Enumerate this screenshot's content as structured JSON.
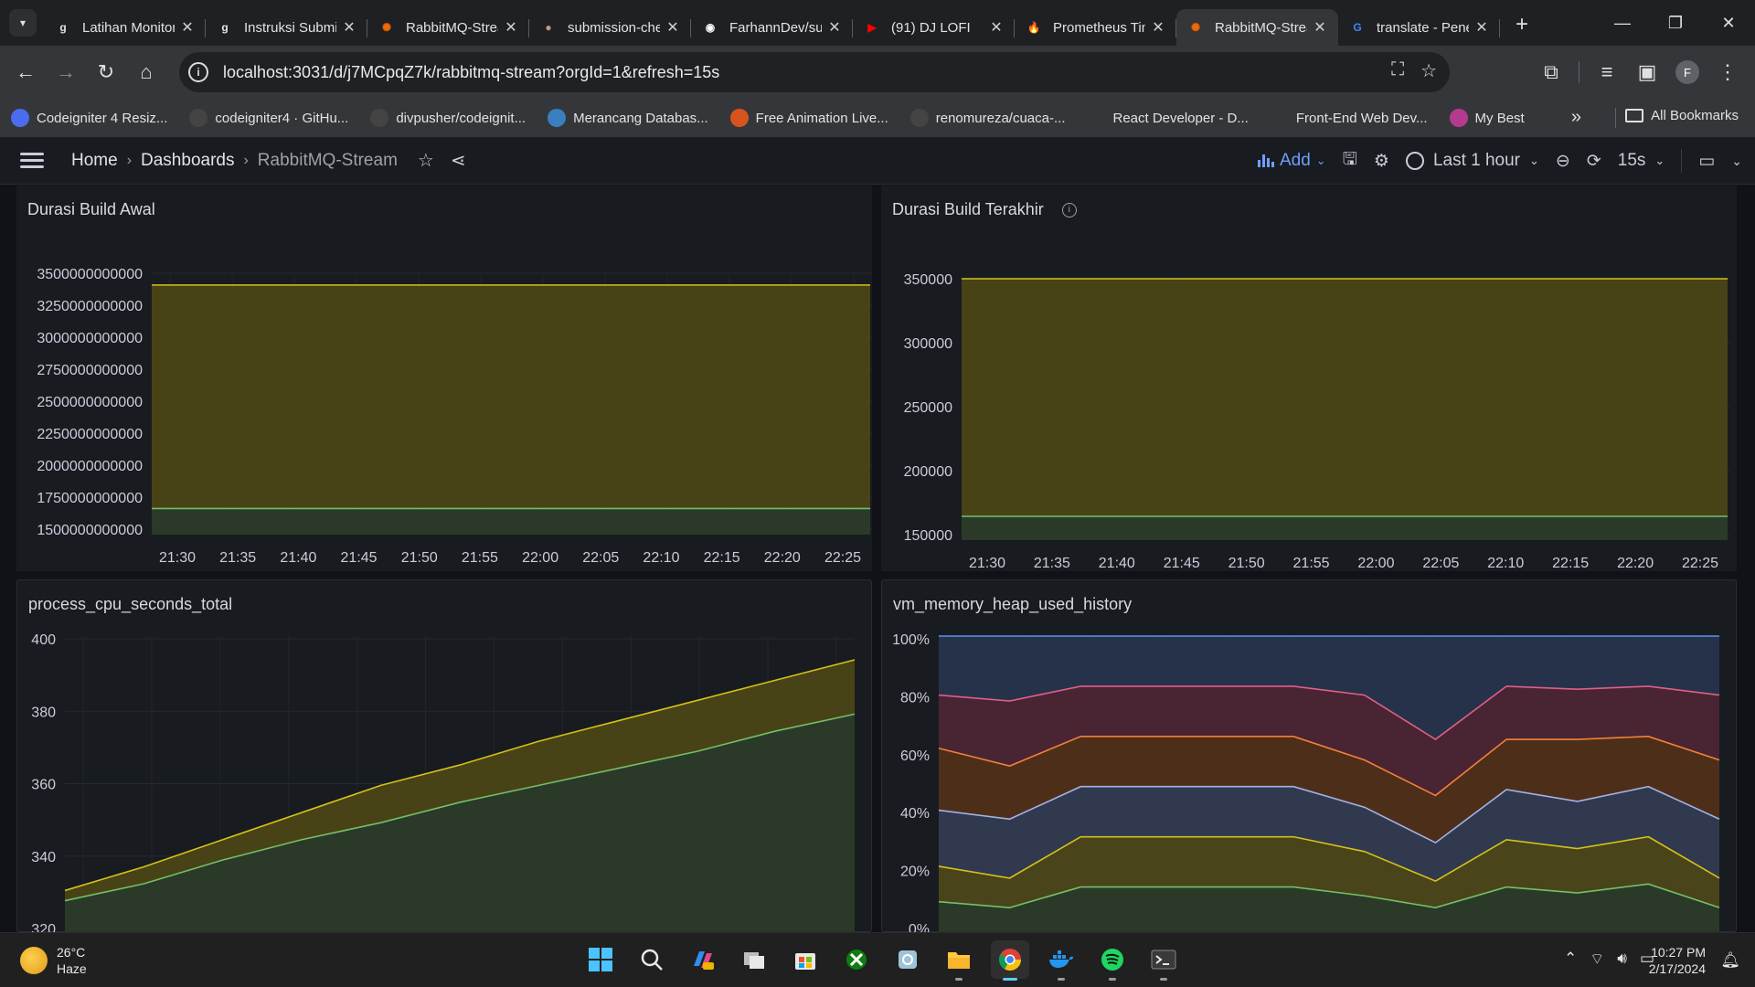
{
  "browser": {
    "tabs": [
      {
        "title": "Latihan Monitoring",
        "icon": "grafana-g",
        "color": "#e3e3e3",
        "bg": "transparent",
        "active": false
      },
      {
        "title": "Instruksi Submission",
        "icon": "grafana-g",
        "color": "#e3e3e3",
        "bg": "transparent",
        "active": false
      },
      {
        "title": "RabbitMQ-Stream",
        "icon": "grafana-logo",
        "color": "#f46800",
        "bg": "transparent",
        "active": false
      },
      {
        "title": "submission-checker",
        "icon": "avatar",
        "color": "#c59a7a",
        "bg": "transparent",
        "active": false
      },
      {
        "title": "FarhannDev/submission",
        "icon": "github",
        "color": "#ffffff",
        "bg": "transparent",
        "active": false
      },
      {
        "title": "(91) DJ LOFI",
        "icon": "youtube",
        "color": "#ff0000",
        "bg": "transparent",
        "active": false
      },
      {
        "title": "Prometheus Time Series",
        "icon": "prometheus",
        "color": "#e6522c",
        "bg": "transparent",
        "active": false
      },
      {
        "title": "RabbitMQ-Stream",
        "icon": "grafana-logo",
        "color": "#f46800",
        "bg": "transparent",
        "active": true
      },
      {
        "title": "translate - Penelusuran",
        "icon": "google",
        "color": "#4285f4",
        "bg": "transparent",
        "active": false
      }
    ],
    "url_host": "localhost:3031",
    "url_path": "/d/j7MCpqZ7k/rabbitmq-stream?orgId=1&refresh=15s",
    "avatar_letter": "F",
    "bookmarks": [
      {
        "label": "Codeigniter 4 Resiz...",
        "icon": "gear-icon",
        "color": "#4b6cf0"
      },
      {
        "label": "codeigniter4 · GitHu...",
        "icon": "github-icon",
        "color": "#444"
      },
      {
        "label": "divpusher/codeignit...",
        "icon": "github-icon",
        "color": "#444"
      },
      {
        "label": "Merancang Databas...",
        "icon": "wordpress-icon",
        "color": "#3a7fbf"
      },
      {
        "label": "Free Animation Live...",
        "icon": "animation-icon",
        "color": "#d9531e"
      },
      {
        "label": "renomureza/cuaca-...",
        "icon": "github-icon",
        "color": "#444"
      },
      {
        "label": "React Developer - D...",
        "icon": "grafana-g",
        "color": "#35363a"
      },
      {
        "label": "Front-End Web Dev...",
        "icon": "grafana-g",
        "color": "#35363a"
      },
      {
        "label": "My Best",
        "icon": "m-icon",
        "color": "#b53a8e"
      }
    ],
    "all_bookmarks": "All Bookmarks"
  },
  "grafana": {
    "breadcrumb": [
      "Home",
      "Dashboards",
      "RabbitMQ-Stream"
    ],
    "add_label": "Add",
    "time_range": "Last 1 hour",
    "refresh": "15s"
  },
  "panels": {
    "p1": {
      "title": "Durasi Build Awal"
    },
    "p2": {
      "title": "Durasi Build Terakhir"
    },
    "p3": {
      "title": "process_cpu_seconds_total"
    },
    "p4": {
      "title": "vm_memory_heap_used_history"
    }
  },
  "chart_data": [
    {
      "type": "area",
      "title": "Durasi Build Awal",
      "x": [
        "21:30",
        "21:35",
        "21:40",
        "21:45",
        "21:50",
        "21:55",
        "22:00",
        "22:05",
        "22:10",
        "22:15",
        "22:20",
        "22:25"
      ],
      "y_ticks": [
        "3500000000000",
        "3250000000000",
        "3000000000000",
        "2750000000000",
        "2500000000000",
        "2250000000000",
        "2000000000000",
        "1750000000000",
        "1500000000000"
      ],
      "ylim": [
        1500000000000,
        3500000000000
      ],
      "series": [
        {
          "color": "#d4c11a",
          "fill": "#4b4417",
          "values": [
            3410000000000,
            3410000000000
          ]
        },
        {
          "color": "#73bf69",
          "fill": "#2a3a29",
          "values": [
            1700000000000,
            1700000000000
          ]
        }
      ]
    },
    {
      "type": "area",
      "title": "Durasi Build Terakhir",
      "x": [
        "21:30",
        "21:35",
        "21:40",
        "21:45",
        "21:50",
        "21:55",
        "22:00",
        "22:05",
        "22:10",
        "22:15",
        "22:20",
        "22:25"
      ],
      "y_ticks": [
        "350000",
        "300000",
        "250000",
        "200000",
        "150000"
      ],
      "ylim": [
        130000,
        350000
      ],
      "series": [
        {
          "color": "#d4c11a",
          "fill": "#4b4417",
          "values": [
            350000,
            350000
          ]
        },
        {
          "color": "#73bf69",
          "fill": "#2a3a29",
          "values": [
            150000,
            150000
          ]
        }
      ]
    },
    {
      "type": "area",
      "title": "process_cpu_seconds_total",
      "y_ticks": [
        "400",
        "380",
        "360",
        "340",
        "320"
      ],
      "ylim": [
        313,
        400
      ],
      "series": [
        {
          "color": "#d4c11a",
          "fill": "#4b4417",
          "values": [
            325,
            332,
            340,
            348,
            356,
            362,
            369,
            375,
            381,
            387,
            393
          ]
        },
        {
          "color": "#73bf69",
          "fill": "#2a3a29",
          "values": [
            322,
            327,
            334,
            340,
            345,
            351,
            356,
            361,
            366,
            372,
            377
          ]
        }
      ]
    },
    {
      "type": "area",
      "title": "vm_memory_heap_used_history",
      "y_ticks": [
        "100%",
        "80%",
        "60%",
        "40%",
        "20%",
        "0%"
      ],
      "ylim": [
        0,
        100
      ],
      "series": [
        {
          "color": "#5794f2",
          "fill": "#27344d",
          "values": [
            100,
            100,
            100,
            100,
            100,
            100,
            100,
            100,
            100,
            100,
            100,
            100
          ]
        },
        {
          "color": "#e05f88",
          "fill": "#4b2432",
          "values": [
            80,
            78,
            83,
            83,
            83,
            83,
            80,
            65,
            83,
            82,
            83,
            80
          ]
        },
        {
          "color": "#f2813a",
          "fill": "#4e3018",
          "values": [
            62,
            56,
            66,
            66,
            66,
            66,
            58,
            46,
            65,
            65,
            66,
            58
          ]
        },
        {
          "color": "#a4b1e6",
          "fill": "#2f3a52",
          "values": [
            41,
            38,
            49,
            49,
            49,
            49,
            42,
            30,
            48,
            44,
            49,
            38
          ]
        },
        {
          "color": "#d4c11a",
          "fill": "#4b4417",
          "values": [
            22,
            18,
            32,
            32,
            32,
            32,
            27,
            17,
            31,
            28,
            32,
            18
          ]
        },
        {
          "color": "#73bf69",
          "fill": "#2a3a29",
          "values": [
            10,
            8,
            15,
            15,
            15,
            15,
            12,
            8,
            15,
            13,
            16,
            8
          ]
        }
      ]
    }
  ],
  "taskbar": {
    "temp": "26°C",
    "weather": "Haze",
    "time": "10:27 PM",
    "date": "2/17/2024"
  }
}
